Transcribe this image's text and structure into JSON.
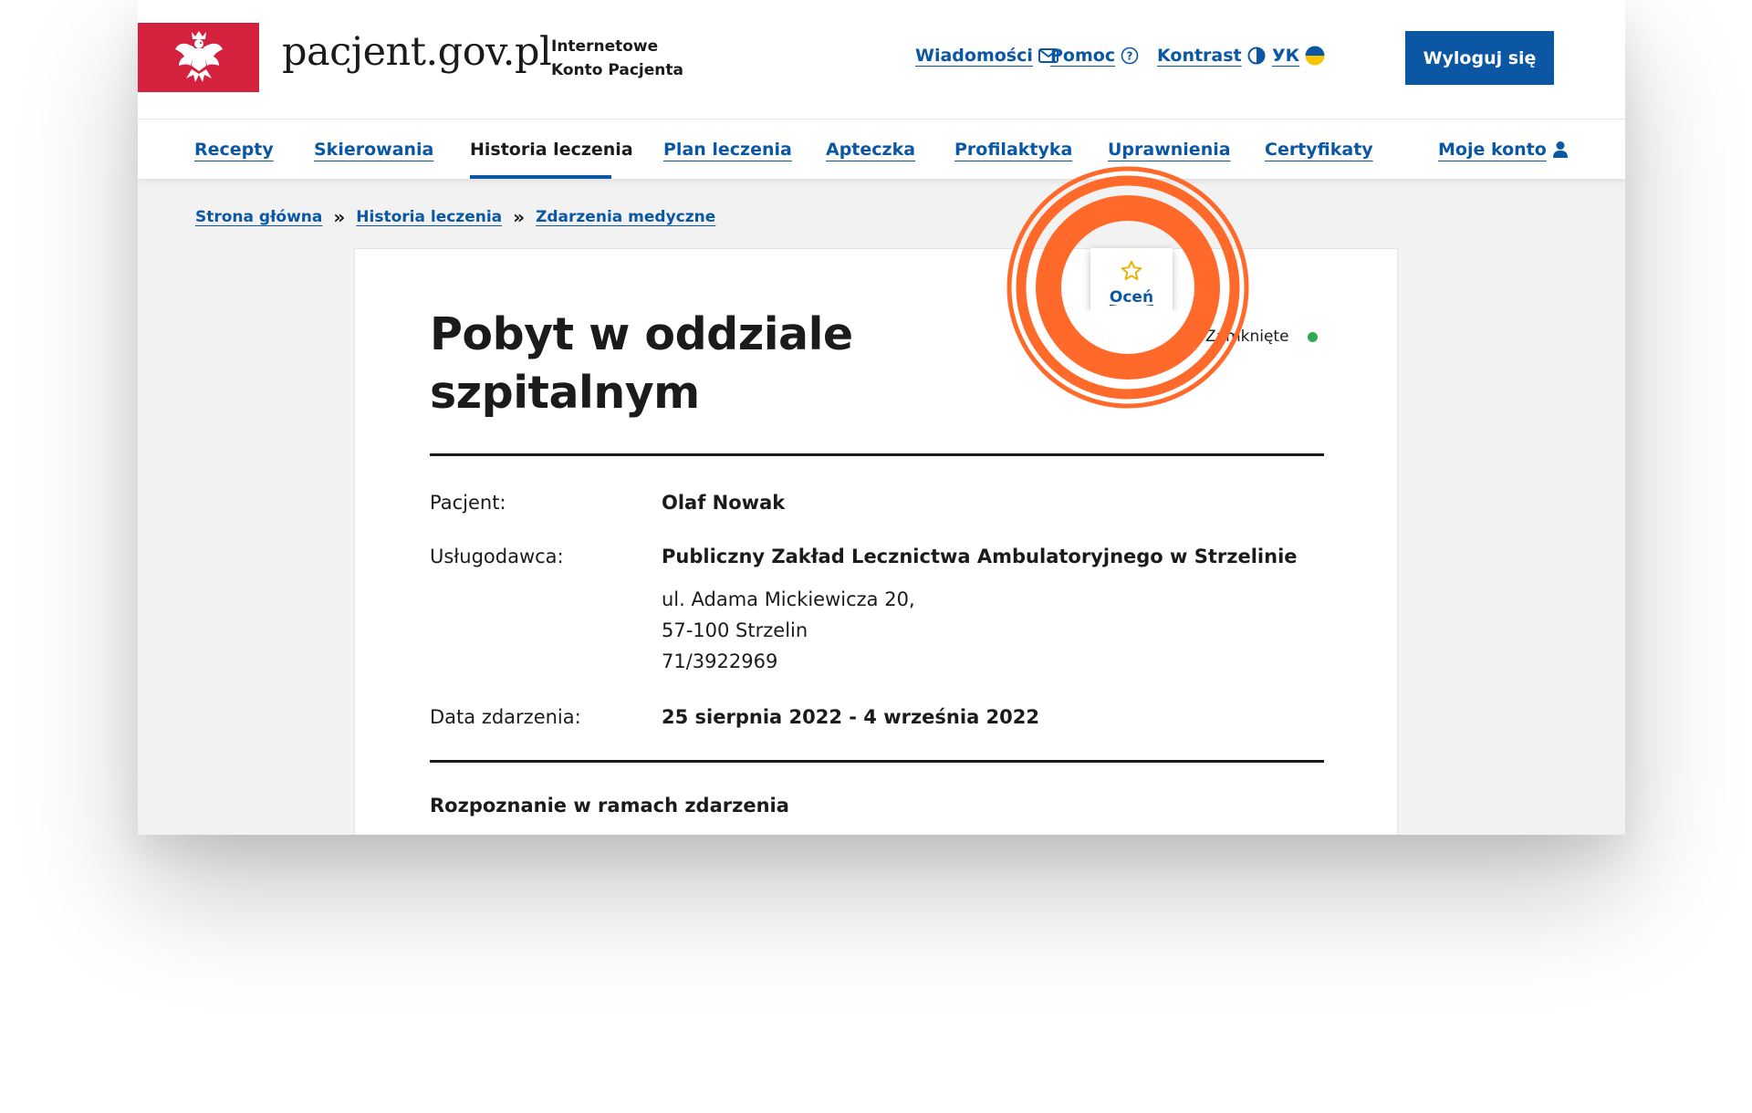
{
  "header": {
    "brand": "pacjent.gov.pl",
    "subtitle_line1": "Internetowe",
    "subtitle_line2": "Konto Pacjenta",
    "links": {
      "messages": "Wiadomości",
      "help": "Pomoc",
      "contrast": "Kontrast",
      "language": "УК"
    },
    "logout_label": "Wyloguj się"
  },
  "nav": {
    "items": [
      "Recepty",
      "Skierowania",
      "Historia leczenia",
      "Plan leczenia",
      "Apteczka",
      "Profilaktyka",
      "Uprawnienia",
      "Certyfikaty"
    ],
    "account": "Moje konto",
    "active": "Historia leczenia"
  },
  "breadcrumb": [
    "Strona główna",
    "Historia leczenia",
    "Zdarzenia medyczne"
  ],
  "breadcrumb_separator": "»",
  "event": {
    "title": "Pobyt w oddziale szpitalnym",
    "status": "Zamknięte",
    "rate_label": "Oceń",
    "fields": {
      "patient_label": "Pacjent:",
      "patient_value": "Olaf Nowak",
      "provider_label": "Usługodawca:",
      "provider_name": "Publiczny Zakład Lecznictwa Ambulatoryjnego w Strzelinie",
      "provider_address1": "ul. Adama Mickiewicza 20,",
      "provider_address2": "57-100 Strzelin",
      "provider_phone": "71/3922969",
      "date_label": "Data zdarzenia:",
      "date_value": "25 sierpnia 2022 - 4 września 2022"
    },
    "diagnosis_title": "Rozpoznanie w ramach zdarzenia"
  },
  "colors": {
    "link_blue": "#0b57a4",
    "brand_red": "#d4213d",
    "highlight_orange": "#ff6a2b",
    "status_green": "#2fa84f"
  },
  "icons": [
    "eagle-emblem-icon",
    "envelope-icon",
    "question-circle-icon",
    "contrast-icon",
    "ukraine-flag-icon",
    "user-icon",
    "star-icon"
  ]
}
